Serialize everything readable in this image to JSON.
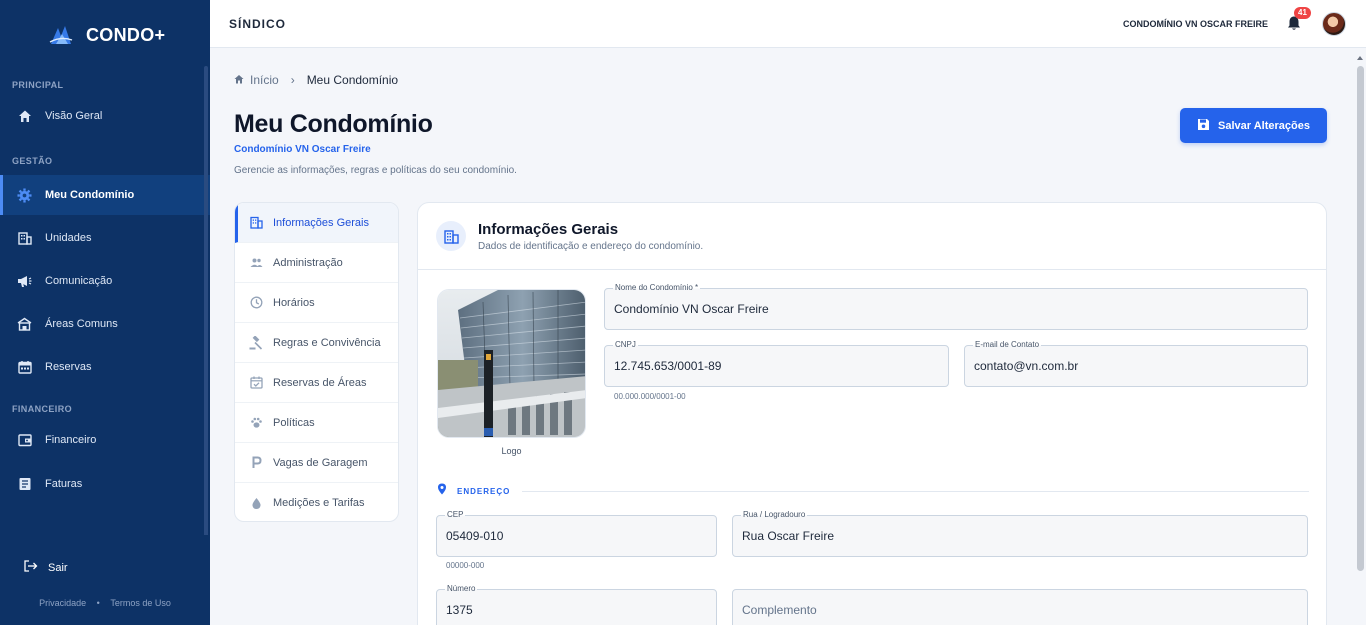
{
  "app": {
    "brand": "CONDO+"
  },
  "sidebar": {
    "sections": [
      {
        "title": "PRINCIPAL",
        "items": [
          {
            "label": "Visão Geral",
            "icon": "home-icon"
          }
        ]
      },
      {
        "title": "GESTÃO",
        "items": [
          {
            "label": "Meu Condomínio",
            "icon": "gear-icon",
            "active": true
          },
          {
            "label": "Unidades",
            "icon": "building-icon"
          },
          {
            "label": "Comunicação",
            "icon": "megaphone-icon"
          },
          {
            "label": "Áreas Comuns",
            "icon": "pool-icon"
          },
          {
            "label": "Reservas",
            "icon": "calendar-icon"
          }
        ]
      },
      {
        "title": "FINANCEIRO",
        "items": [
          {
            "label": "Financeiro",
            "icon": "wallet-icon"
          },
          {
            "label": "Faturas",
            "icon": "invoice-icon"
          }
        ]
      }
    ],
    "logout": "Sair",
    "privacy": "Privacidade",
    "terms": "Termos de Uso",
    "separator": "•"
  },
  "topbar": {
    "title": "SÍNDICO",
    "condo": "CONDOMÍNIO VN OSCAR FREIRE",
    "notifications": "41"
  },
  "breadcrumb": {
    "home": "Início",
    "separator": "›",
    "current": "Meu Condomínio"
  },
  "page": {
    "title": "Meu Condomínio",
    "subtitle": "Condomínio VN Oscar Freire",
    "description": "Gerencie as informações, regras e políticas do seu condomínio.",
    "save_label": "Salvar Alterações"
  },
  "menu": {
    "items": [
      {
        "label": "Informações Gerais",
        "icon": "building-icon",
        "active": true
      },
      {
        "label": "Administração",
        "icon": "users-icon"
      },
      {
        "label": "Horários",
        "icon": "clock-icon"
      },
      {
        "label": "Regras e Convivência",
        "icon": "gavel-icon"
      },
      {
        "label": "Reservas de Áreas",
        "icon": "calendar-check-icon"
      },
      {
        "label": "Políticas",
        "icon": "paw-icon"
      },
      {
        "label": "Vagas de Garagem",
        "icon": "parking-icon"
      },
      {
        "label": "Medições e Tarifas",
        "icon": "drop-icon"
      }
    ]
  },
  "card": {
    "title": "Informações Gerais",
    "description": "Dados de identificação e endereço do condomínio.",
    "logo_label": "Logo",
    "fields": {
      "name": {
        "label": "Nome do Condomínio *",
        "value": "Condomínio VN Oscar Freire"
      },
      "cnpj": {
        "label": "CNPJ",
        "value": "12.745.653/0001-89",
        "helper": "00.000.000/0001-00"
      },
      "email": {
        "label": "E-mail de Contato",
        "value": "contato@vn.com.br"
      }
    },
    "address": {
      "heading": "ENDEREÇO",
      "cep": {
        "label": "CEP",
        "value": "05409-010",
        "helper": "00000-000"
      },
      "street": {
        "label": "Rua / Logradouro",
        "value": "Rua Oscar Freire"
      },
      "number": {
        "label": "Número",
        "value": "1375"
      },
      "complement": {
        "placeholder": "Complemento"
      }
    }
  },
  "colors": {
    "sidebar": "#0d3266",
    "accent": "#2563eb",
    "badge": "#ef4444"
  }
}
